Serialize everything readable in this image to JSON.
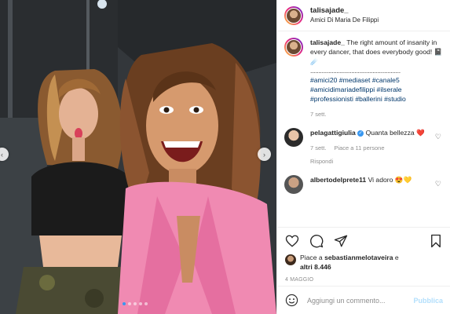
{
  "post": {
    "username": "talisajade_",
    "location": "Amici Di Maria De Filippi"
  },
  "caption": {
    "username": "talisajade_",
    "text": "The right amount of insanity in every dancer, that does everybody good! 📓☄️",
    "dots": ".......................................................",
    "hashtags": [
      "#amici20",
      "#mediaset",
      "#canale5",
      "#amicidimariadefilippi",
      "#ilserale",
      "#professionisti",
      "#ballerini",
      "#studio"
    ],
    "time": "7 sett."
  },
  "comments": [
    {
      "username": "pelagattigiulia",
      "verified": true,
      "text": "Quanta bellezza ❤️",
      "time": "7 sett.",
      "likes": "Piace a 11 persone",
      "reply": "Rispondi"
    },
    {
      "username": "albertodelprete11",
      "text": "Vi adoro 😍💛"
    }
  ],
  "likes": {
    "prefix": "Piace a",
    "user": "sebastianmelotaveira",
    "suffix": "e",
    "others": "altri 8.446"
  },
  "date": "4 MAGGIO",
  "add_comment": {
    "placeholder": "Aggiungi un commento...",
    "publish": "Pubblica"
  },
  "carousel": {
    "count": 5,
    "active": 0
  },
  "icons": [
    "heart-icon",
    "comment-icon",
    "share-icon",
    "bookmark-icon",
    "emoji-icon",
    "chevron-left-icon",
    "chevron-right-icon"
  ],
  "colors": {
    "link": "#00376b",
    "blue": "#3897f0",
    "muted": "#8e8e8e",
    "publish": "#b2dffc"
  }
}
